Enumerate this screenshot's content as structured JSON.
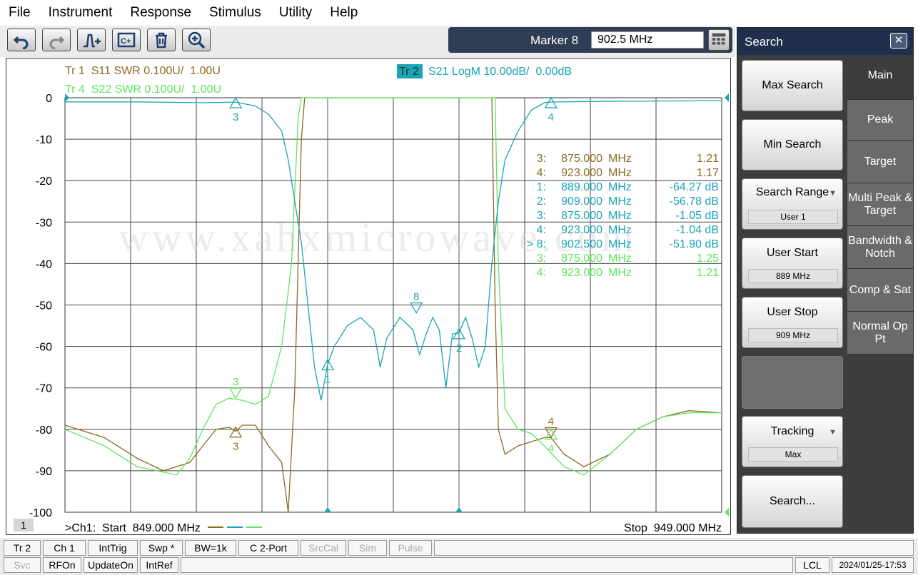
{
  "menu": [
    "File",
    "Instrument",
    "Response",
    "Stimulus",
    "Utility",
    "Help"
  ],
  "toolbar": {
    "buttons": [
      "undo",
      "redo",
      "add-marker",
      "channel",
      "delete",
      "zoom"
    ]
  },
  "marker": {
    "label": "Marker 8",
    "value": "902.5 MHz"
  },
  "traces": {
    "tr1": "Tr 1  S11 SWR 0.100U/  1.00U",
    "tr4": "Tr 4  S22 SWR 0.100U/  1.00U",
    "tr2_tag": "Tr 2",
    "tr2": "S21 LogM 10.00dB/  0.00dB"
  },
  "colors": {
    "s11": "#8b6b1f",
    "s21": "#1ba5b2",
    "s22": "#5fe65f"
  },
  "chart_data": {
    "type": "line",
    "ylim": [
      -100,
      0
    ],
    "xlim": [
      849,
      949
    ],
    "y_ticks": [
      "0",
      "-10",
      "-20",
      "-30",
      "-40",
      "-50",
      "-60",
      "-70",
      "-80",
      "-90",
      "-100"
    ],
    "channel_label": "1",
    "start": ">Ch1:  Start  849.000 MHz",
    "stop": "Stop  949.000 MHz",
    "series": [
      {
        "id": "s21",
        "points": [
          [
            849,
            -1.0
          ],
          [
            860,
            -1.0
          ],
          [
            870,
            -1.2
          ],
          [
            875,
            -1.05
          ],
          [
            878,
            -2
          ],
          [
            880,
            -4
          ],
          [
            882,
            -8
          ],
          [
            883,
            -15
          ],
          [
            884,
            -25
          ],
          [
            885,
            -35
          ],
          [
            886,
            -50
          ],
          [
            887,
            -65
          ],
          [
            888,
            -73
          ],
          [
            889,
            -64.27
          ],
          [
            890,
            -60
          ],
          [
            892,
            -55
          ],
          [
            894,
            -53
          ],
          [
            896,
            -56
          ],
          [
            897,
            -65
          ],
          [
            898,
            -58
          ],
          [
            900,
            -53
          ],
          [
            902,
            -56
          ],
          [
            903,
            -62
          ],
          [
            904,
            -57
          ],
          [
            905,
            -53
          ],
          [
            906,
            -56
          ],
          [
            907,
            -70
          ],
          [
            908,
            -57
          ],
          [
            909,
            -56.78
          ],
          [
            910,
            -53
          ],
          [
            911,
            -58
          ],
          [
            912,
            -65
          ],
          [
            913,
            -60
          ],
          [
            914,
            -40
          ],
          [
            915,
            -25
          ],
          [
            916,
            -15
          ],
          [
            918,
            -8
          ],
          [
            920,
            -3
          ],
          [
            922,
            -1.2
          ],
          [
            923,
            -1.04
          ],
          [
            930,
            -0.9
          ],
          [
            940,
            -0.8
          ],
          [
            949,
            -0.7
          ]
        ]
      },
      {
        "id": "s11",
        "points": [
          [
            849,
            -79
          ],
          [
            855,
            -82
          ],
          [
            860,
            -87
          ],
          [
            864,
            -90
          ],
          [
            868,
            -88
          ],
          [
            870,
            -84
          ],
          [
            872,
            -80
          ],
          [
            874,
            -79.5
          ],
          [
            875,
            -80.5
          ],
          [
            876,
            -79
          ],
          [
            878,
            -79
          ],
          [
            880,
            -84
          ],
          [
            882,
            -88
          ],
          [
            883,
            -100
          ],
          [
            884,
            -70
          ],
          [
            885,
            -10
          ],
          [
            885.5,
            0
          ],
          [
            914,
            0
          ],
          [
            914.5,
            -50
          ],
          [
            915,
            -80
          ],
          [
            916,
            -86
          ],
          [
            918,
            -84
          ],
          [
            920,
            -83
          ],
          [
            922,
            -82
          ],
          [
            923,
            -82
          ],
          [
            925,
            -86
          ],
          [
            928,
            -89
          ],
          [
            932,
            -86
          ],
          [
            936,
            -80
          ],
          [
            940,
            -77
          ],
          [
            944,
            -75.5
          ],
          [
            949,
            -76
          ]
        ]
      },
      {
        "id": "s22",
        "points": [
          [
            849,
            -80
          ],
          [
            855,
            -84
          ],
          [
            860,
            -89
          ],
          [
            866,
            -91
          ],
          [
            868,
            -87
          ],
          [
            870,
            -80
          ],
          [
            872,
            -74
          ],
          [
            874,
            -72.5
          ],
          [
            876,
            -73
          ],
          [
            878,
            -74
          ],
          [
            880,
            -72
          ],
          [
            882,
            -60
          ],
          [
            883.5,
            -40
          ],
          [
            884.5,
            -5
          ],
          [
            885,
            0
          ],
          [
            914.5,
            0
          ],
          [
            915,
            -40
          ],
          [
            916,
            -75
          ],
          [
            918,
            -80
          ],
          [
            920,
            -81
          ],
          [
            922,
            -84
          ],
          [
            925,
            -89
          ],
          [
            928,
            -91
          ],
          [
            932,
            -86
          ],
          [
            936,
            -80
          ],
          [
            940,
            -77
          ],
          [
            944,
            -76
          ],
          [
            949,
            -76
          ]
        ]
      }
    ],
    "markers": [
      {
        "series": "s21",
        "label": "3",
        "x": 875,
        "y": -1.05,
        "dir": "up"
      },
      {
        "series": "s21",
        "label": "4",
        "x": 923,
        "y": -1.04,
        "dir": "up"
      },
      {
        "series": "s21",
        "label": "1",
        "x": 889,
        "y": -64.27,
        "dir": "up"
      },
      {
        "series": "s21",
        "label": "2",
        "x": 909,
        "y": -56.78,
        "dir": "up"
      },
      {
        "series": "s21",
        "label": "8",
        "x": 902.5,
        "y": -51.9,
        "dir": "down"
      },
      {
        "series": "s11",
        "label": "3",
        "x": 875,
        "y": -80.5,
        "dir": "up"
      },
      {
        "series": "s11",
        "label": "4",
        "x": 923,
        "y": -82,
        "dir": "down"
      },
      {
        "series": "s22",
        "label": "3",
        "x": 875,
        "y": -72.5,
        "dir": "down"
      },
      {
        "series": "s22",
        "label": "4",
        "x": 923,
        "y": -81,
        "dir": "up"
      }
    ],
    "marker_table": [
      {
        "series": "s11",
        "num": "3:",
        "freq": "875.000",
        "unit": "MHz",
        "value": "1.21"
      },
      {
        "series": "s11",
        "num": "4:",
        "freq": "923.000",
        "unit": "MHz",
        "value": "1.17"
      },
      {
        "series": "s21",
        "num": "1:",
        "freq": "889.000",
        "unit": "MHz",
        "value": "-64.27 dB"
      },
      {
        "series": "s21",
        "num": "2:",
        "freq": "909.000",
        "unit": "MHz",
        "value": "-56.78 dB"
      },
      {
        "series": "s21",
        "num": "3:",
        "freq": "875.000",
        "unit": "MHz",
        "value": "-1.05 dB"
      },
      {
        "series": "s21",
        "num": "4:",
        "freq": "923.000",
        "unit": "MHz",
        "value": "-1.04 dB"
      },
      {
        "series": "s21",
        "num": "> 8:",
        "freq": "902.500",
        "unit": "MHz",
        "value": "-51.90 dB"
      },
      {
        "series": "s22",
        "num": "3:",
        "freq": "875.000",
        "unit": "MHz",
        "value": "1.25"
      },
      {
        "series": "s22",
        "num": "4:",
        "freq": "923.000",
        "unit": "MHz",
        "value": "1.21"
      }
    ],
    "watermark": "www.xahxmicrowave.com"
  },
  "panel": {
    "title": "Search",
    "buttons": {
      "max_search": "Max Search",
      "min_search": "Min Search",
      "search_range": "Search Range",
      "search_range_val": "User 1",
      "user_start": "User Start",
      "user_start_val": "889 MHz",
      "user_stop": "User Stop",
      "user_stop_val": "909 MHz",
      "tracking": "Tracking",
      "tracking_val": "Max",
      "search_more": "Search..."
    },
    "tabs": [
      "Main",
      "Peak",
      "Target",
      "Multi Peak & Target",
      "Bandwidth & Notch",
      "Comp & Sat",
      "Normal Op Pt"
    ]
  },
  "status": {
    "row1": [
      "Tr 2",
      "Ch 1",
      "IntTrig",
      "Swp *",
      "BW=1k",
      "C  2-Port",
      "SrcCal",
      "Sim",
      "Pulse"
    ],
    "row2": [
      "Svc",
      "RFOn",
      "UpdateOn",
      "IntRef"
    ],
    "lcl": "LCL",
    "datetime": "2024/01/25-17:53"
  }
}
